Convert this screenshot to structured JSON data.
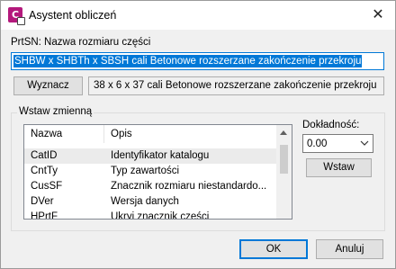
{
  "window": {
    "title": "Asystent obliczeń",
    "app_icon_letter": "C"
  },
  "name_section": {
    "label": "PrtSN: Nazwa rozmiaru części",
    "input_value": "SHBW x SHBTh x SBSH cali Betonowe rozszerzane zakończenie przekroju"
  },
  "evaluate": {
    "button_label": "Wyznacz",
    "result_value": "38 x 6 x 37 cali Betonowe rozszerzane zakończenie przekroju"
  },
  "insert_group": {
    "label": "Wstaw zmienną",
    "columns": [
      "Nazwa",
      "Opis"
    ],
    "rows": [
      {
        "name": "CatID",
        "desc": "Identyfikator katalogu"
      },
      {
        "name": "CntTy",
        "desc": "Typ zawartości"
      },
      {
        "name": "CusSF",
        "desc": "Znacznik rozmiaru niestandardo..."
      },
      {
        "name": "DVer",
        "desc": "Wersja danych"
      },
      {
        "name": "HPrtF",
        "desc": "Ukryj znacznik części"
      }
    ],
    "precision_label": "Dokładność:",
    "precision_value": "0.00",
    "insert_button": "Wstaw"
  },
  "footer": {
    "ok_label": "OK",
    "cancel_label": "Anuluj"
  },
  "colors": {
    "accent": "#0078d7",
    "app_icon": "#b4197c"
  }
}
